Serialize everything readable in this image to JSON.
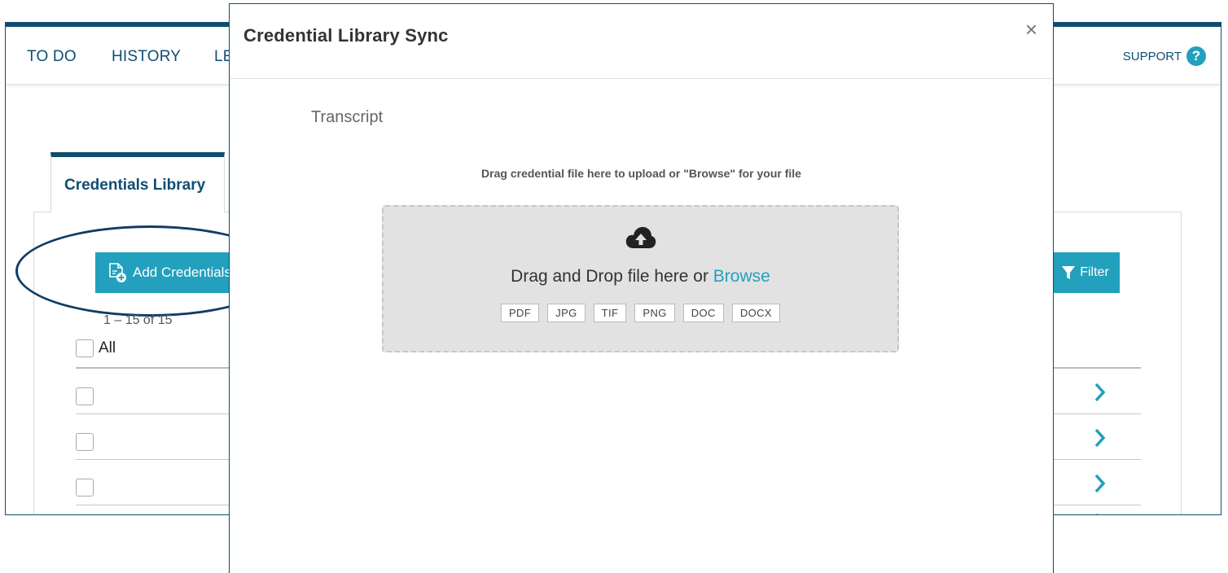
{
  "nav": {
    "items": [
      "TO DO",
      "HISTORY",
      "LE"
    ],
    "support_label": "SUPPORT",
    "support_icon": "help-circle-icon"
  },
  "library": {
    "tab_label": "Credentials Library",
    "add_button_label": "Add Credentials",
    "filter_button_label": "Filter",
    "count_text": "1 – 15 of 15",
    "all_label": "All"
  },
  "modal": {
    "title": "Credential Library Sync",
    "close_symbol": "×",
    "section_label": "Transcript",
    "drag_hint": "Drag credential file here to upload or \"Browse\" for your file",
    "drop_text": "Drag and Drop file here or",
    "browse_label": "Browse",
    "file_types": [
      "PDF",
      "JPG",
      "TIF",
      "PNG",
      "DOC",
      "DOCX"
    ],
    "upload_icon": "cloud-upload-icon"
  },
  "colors": {
    "brand_navy": "#0f4c6e",
    "accent_teal": "#22a0bd",
    "dropzone_bg": "#e2e2e2"
  }
}
